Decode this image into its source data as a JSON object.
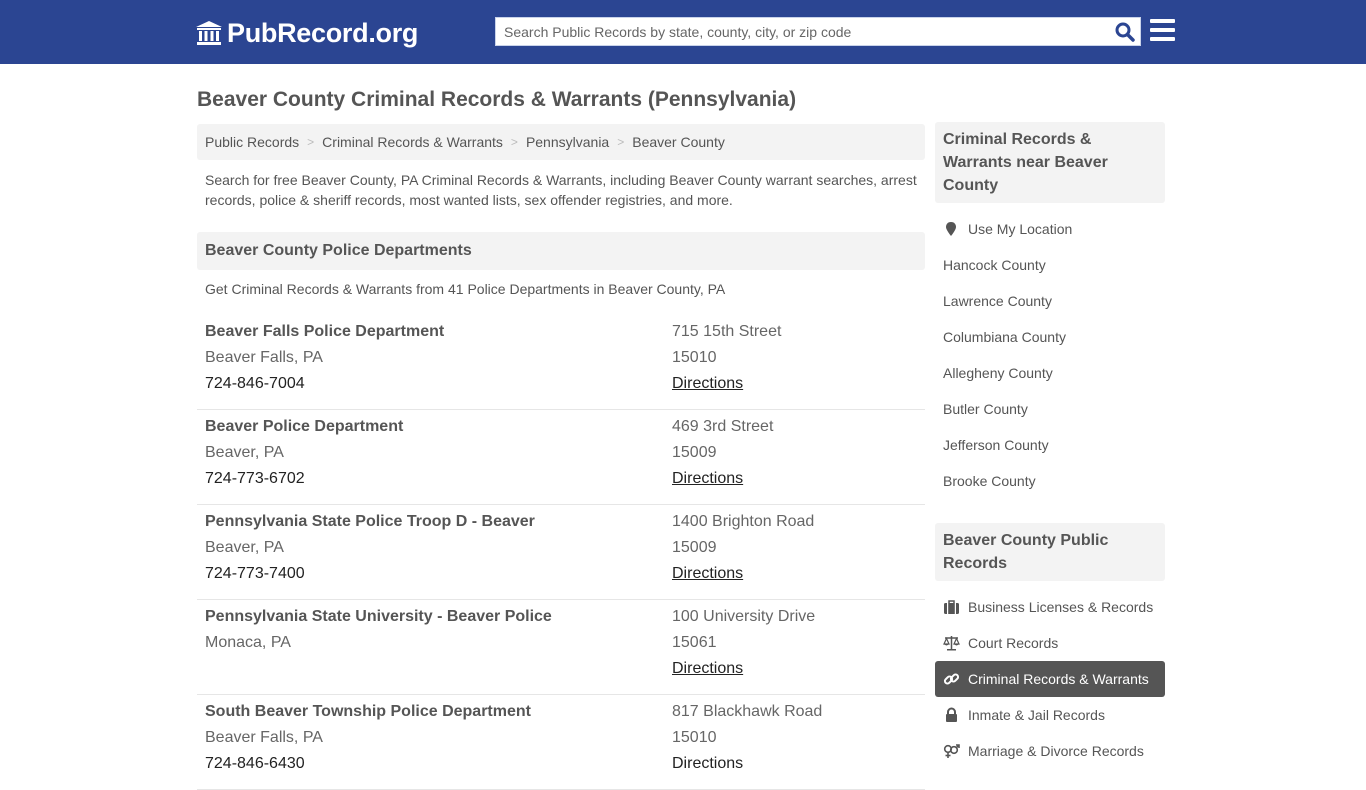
{
  "header": {
    "logo_text": "PubRecord.org",
    "search_placeholder": "Search Public Records by state, county, city, or zip code"
  },
  "page": {
    "title": "Beaver County Criminal Records & Warrants (Pennsylvania)",
    "breadcrumb": [
      "Public Records",
      "Criminal Records & Warrants",
      "Pennsylvania",
      "Beaver County"
    ],
    "intro": "Search for free Beaver County, PA Criminal Records & Warrants, including Beaver County warrant searches, arrest records, police & sheriff records, most wanted lists, sex offender registries, and more."
  },
  "departments": {
    "heading": "Beaver County Police Departments",
    "subtitle": "Get Criminal Records & Warrants from 41 Police Departments in Beaver County, PA",
    "directions_label": "Directions",
    "items": [
      {
        "name": "Beaver Falls Police Department",
        "city": "Beaver Falls, PA",
        "phone": "724-846-7004",
        "address": "715 15th Street",
        "zip": "15010"
      },
      {
        "name": "Beaver Police Department",
        "city": "Beaver, PA",
        "phone": "724-773-6702",
        "address": "469 3rd Street",
        "zip": "15009"
      },
      {
        "name": "Pennsylvania State Police Troop D - Beaver",
        "city": "Beaver, PA",
        "phone": "724-773-7400",
        "address": "1400 Brighton Road",
        "zip": "15009"
      },
      {
        "name": "Pennsylvania State University - Beaver Police",
        "city": "Monaca, PA",
        "phone": "",
        "address": "100 University Drive",
        "zip": "15061"
      },
      {
        "name": "South Beaver Township Police Department",
        "city": "Beaver Falls, PA",
        "phone": "724-846-6430",
        "address": "817 Blackhawk Road",
        "zip": "15010"
      }
    ]
  },
  "sidebar": {
    "near": {
      "heading": "Criminal Records & Warrants near Beaver County",
      "use_location": "Use My Location",
      "counties": [
        "Hancock County",
        "Lawrence County",
        "Columbiana County",
        "Allegheny County",
        "Butler County",
        "Jefferson County",
        "Brooke County"
      ]
    },
    "public_records": {
      "heading": "Beaver County Public Records",
      "items": [
        {
          "label": "Business Licenses & Records",
          "icon": "briefcase-icon",
          "active": false
        },
        {
          "label": "Court Records",
          "icon": "scales-icon",
          "active": false
        },
        {
          "label": "Criminal Records & Warrants",
          "icon": "link-icon",
          "active": true
        },
        {
          "label": "Inmate & Jail Records",
          "icon": "lock-icon",
          "active": false
        },
        {
          "label": "Marriage & Divorce Records",
          "icon": "venus-mars-icon",
          "active": false
        }
      ]
    }
  },
  "colors": {
    "header_bg": "#2b4592",
    "active_item_bg": "#555555"
  }
}
